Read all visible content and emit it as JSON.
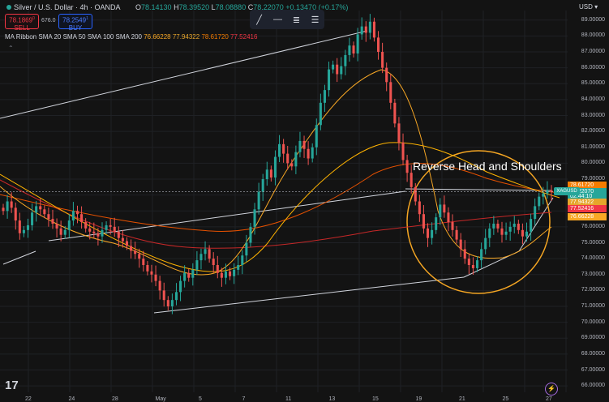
{
  "header": {
    "symbol_title": "Silver / U.S. Dollar · 4h · OANDA",
    "ohlc": {
      "o_label": "O",
      "o_value": "78.14130",
      "h_label": "H",
      "h_value": "78.39520",
      "l_label": "L",
      "l_value": "78.08880",
      "c_label": "C",
      "c_value": "78.22070",
      "change": "+0.13470 (+0.17%)"
    },
    "sell_price": "78.1869",
    "sell_sup": "0",
    "sell_label": "SELL",
    "spread": "676.0",
    "buy_price": "78.2549",
    "buy_sup": "1",
    "buy_label": "BUY",
    "ma_ribbon": {
      "label": "MA Ribbon SMA 20 SMA 50 SMA 100 SMA 200",
      "v1": "76.66228",
      "v2": "77.94322",
      "v3": "78.61720",
      "v4": "77.52416"
    },
    "collapse_icon": "chevron-up-icon"
  },
  "toolbar": {
    "icons": [
      "trend-line-icon",
      "horizontal-line-icon",
      "fibonacci-icon",
      "text-icon"
    ]
  },
  "currency": "USD",
  "annotation": "Reverse Head and Shoulders",
  "symbol_tag": "XAGUSD",
  "price_tags": [
    {
      "text": "78.61720",
      "price": 78.6172,
      "color": "#f57c00"
    },
    {
      "text": "78.22070",
      "price": 78.2207,
      "color": "#26a69a"
    },
    {
      "text": "02:44:10",
      "price": 77.92,
      "color": "#26a69a"
    },
    {
      "text": "77.94322",
      "price": 77.55,
      "color": "#e6a52b"
    },
    {
      "text": "77.52416",
      "price": 77.16,
      "color": "#f23645"
    },
    {
      "text": "76.66228",
      "price": 76.62,
      "color": "#f9a825"
    }
  ],
  "x_labels": [
    "22",
    "24",
    "28",
    "May",
    "5",
    "7",
    "11",
    "13",
    "15",
    "19",
    "21",
    "25",
    "27"
  ],
  "chart_data": {
    "type": "candlestick",
    "title": "Silver / U.S. Dollar · 4h · OANDA",
    "ylim": [
      65.6,
      89.6
    ],
    "y_ticks": [
      66,
      67,
      68,
      69,
      70,
      71,
      72,
      73,
      74,
      75,
      76,
      77,
      78,
      79,
      80,
      81,
      82,
      83,
      84,
      85,
      86,
      87,
      88,
      89
    ],
    "grid": true,
    "close_series": [
      77.0,
      77.6,
      77.2,
      76.4,
      75.6,
      75.8,
      76.1,
      76.9,
      77.3,
      77.1,
      76.8,
      76.5,
      76.2,
      75.9,
      75.5,
      75.8,
      76.4,
      77.0,
      76.8,
      76.3,
      75.9,
      75.7,
      75.6,
      75.4,
      75.8,
      76.1,
      76.0,
      75.7,
      75.3,
      75.1,
      74.8,
      74.5,
      74.3,
      74.0,
      73.6,
      73.2,
      73.0,
      72.6,
      72.0,
      71.4,
      71.0,
      71.4,
      71.9,
      72.6,
      73.1,
      72.8,
      73.3,
      73.9,
      74.3,
      74.6,
      74.0,
      73.6,
      73.1,
      72.8,
      73.2,
      72.9,
      73.3,
      73.6,
      74.2,
      75.0,
      76.0,
      77.1,
      78.2,
      79.0,
      79.6,
      79.1,
      80.4,
      81.2,
      80.6,
      80.0,
      79.8,
      80.7,
      81.4,
      80.9,
      80.3,
      81.0,
      82.4,
      83.8,
      84.6,
      85.9,
      86.2,
      85.6,
      86.1,
      86.8,
      87.4,
      86.9,
      88.1,
      88.6,
      88.2,
      88.9,
      87.9,
      87.0,
      86.0,
      85.1,
      83.8,
      82.5,
      81.3,
      80.2,
      79.4,
      78.5,
      77.6,
      76.8,
      75.9,
      75.3,
      75.8,
      76.6,
      77.4,
      76.9,
      76.3,
      75.8,
      75.2,
      74.6,
      74.0,
      73.6,
      73.4,
      73.9,
      74.6,
      75.3,
      75.9,
      76.2,
      75.9,
      75.5,
      75.7,
      76.0,
      76.2,
      75.8,
      75.4,
      75.7,
      76.5,
      77.3,
      77.9,
      78.1,
      78.3,
      78.2
    ],
    "moving_averages": [
      {
        "name": "SMA 20",
        "value": 76.66228,
        "color": "#f9a825"
      },
      {
        "name": "SMA 50",
        "value": 77.94322,
        "color": "#e6a52b"
      },
      {
        "name": "SMA 100",
        "value": 78.6172,
        "color": "#f57c00"
      },
      {
        "name": "SMA 200",
        "value": 77.52416,
        "color": "#f23645"
      }
    ],
    "last_price": 78.2207
  }
}
